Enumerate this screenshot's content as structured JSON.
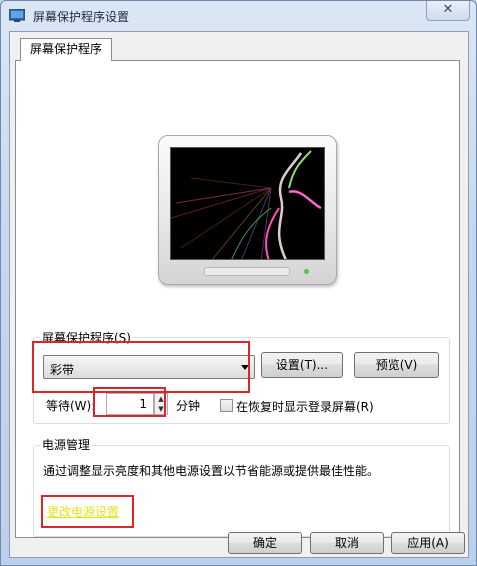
{
  "window": {
    "title": "屏幕保护程序设置",
    "close_glyph": "✕",
    "tab_label": "屏幕保护程序"
  },
  "screensaver": {
    "group_label": "屏幕保护程序(S)",
    "selected": "彩带",
    "settings_button": "设置(T)...",
    "preview_button": "预览(V)",
    "wait_label": "等待(W):",
    "wait_value": "1",
    "wait_unit": "分钟",
    "resume_logon_label": "在恢复时显示登录屏幕(R)",
    "resume_logon_checked": false
  },
  "power": {
    "group_label": "电源管理",
    "description": "通过调整显示亮度和其他电源设置以节省能源或提供最佳性能。",
    "link": "更改电源设置"
  },
  "footer": {
    "ok_button": "确定",
    "cancel_button": "取消",
    "apply_button": "应用(A)"
  },
  "colors": {
    "highlight_box": "#d9262a",
    "link": "#e3e31f"
  }
}
